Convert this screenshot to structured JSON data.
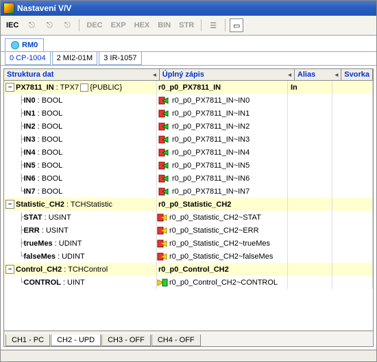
{
  "window": {
    "title": "Nastavení V/V"
  },
  "toolbar": {
    "iec": "IEC",
    "dec": "DEC",
    "exp": "EXP",
    "hex": "HEX",
    "bin": "BIN",
    "str": "STR"
  },
  "rm": {
    "label": "RM0"
  },
  "modules": [
    {
      "idx": "0",
      "name": "CP-1004"
    },
    {
      "idx": "2",
      "name": "MI2-01M"
    },
    {
      "idx": "3",
      "name": "IR-1057"
    }
  ],
  "columns": {
    "c1": "Struktura dat",
    "c2": "Úplný zápis",
    "c3": "Alias",
    "c4": "Svorka"
  },
  "rows": [
    {
      "kind": "group",
      "depth": 0,
      "name": "PX7811_IN",
      "type": "TPX7",
      "mod": "{PUBLIC}",
      "full": "r0_p0_PX7811_IN",
      "alias": "In",
      "icon": "none"
    },
    {
      "kind": "leaf",
      "depth": 1,
      "name": "IN0",
      "type": "BOOL",
      "full": "r0_p0_PX7811_IN~IN0",
      "icon": "green"
    },
    {
      "kind": "leaf",
      "depth": 1,
      "name": "IN1",
      "type": "BOOL",
      "full": "r0_p0_PX7811_IN~IN1",
      "icon": "green"
    },
    {
      "kind": "leaf",
      "depth": 1,
      "name": "IN2",
      "type": "BOOL",
      "full": "r0_p0_PX7811_IN~IN2",
      "icon": "green"
    },
    {
      "kind": "leaf",
      "depth": 1,
      "name": "IN3",
      "type": "BOOL",
      "full": "r0_p0_PX7811_IN~IN3",
      "icon": "green"
    },
    {
      "kind": "leaf",
      "depth": 1,
      "name": "IN4",
      "type": "BOOL",
      "full": "r0_p0_PX7811_IN~IN4",
      "icon": "green"
    },
    {
      "kind": "leaf",
      "depth": 1,
      "name": "IN5",
      "type": "BOOL",
      "full": "r0_p0_PX7811_IN~IN5",
      "icon": "green"
    },
    {
      "kind": "leaf",
      "depth": 1,
      "name": "IN6",
      "type": "BOOL",
      "full": "r0_p0_PX7811_IN~IN6",
      "icon": "green"
    },
    {
      "kind": "leaf",
      "depth": 1,
      "last": true,
      "name": "IN7",
      "type": "BOOL",
      "full": "r0_p0_PX7811_IN~IN7",
      "icon": "green"
    },
    {
      "kind": "group",
      "depth": 0,
      "name": "Statistic_CH2",
      "type": "TCHStatistic",
      "full": "r0_p0_Statistic_CH2",
      "icon": "none"
    },
    {
      "kind": "leaf",
      "depth": 1,
      "name": "STAT",
      "type": "USINT",
      "full": "r0_p0_Statistic_CH2~STAT",
      "icon": "yellow"
    },
    {
      "kind": "leaf",
      "depth": 1,
      "name": "ERR",
      "type": "USINT",
      "full": "r0_p0_Statistic_CH2~ERR",
      "icon": "yellow"
    },
    {
      "kind": "leaf",
      "depth": 1,
      "name": "trueMes",
      "type": "UDINT",
      "full": "r0_p0_Statistic_CH2~trueMes",
      "icon": "yellow"
    },
    {
      "kind": "leaf",
      "depth": 1,
      "last": true,
      "name": "falseMes",
      "type": "UDINT",
      "full": "r0_p0_Statistic_CH2~falseMes",
      "icon": "yellow"
    },
    {
      "kind": "group",
      "depth": 0,
      "name": "Control_CH2",
      "type": "TCHControl",
      "full": "r0_p0_Control_CH2",
      "icon": "none"
    },
    {
      "kind": "leaf",
      "depth": 1,
      "last": true,
      "name": "CONTROL",
      "type": "UINT",
      "full": "r0_p0_Control_CH2~CONTROL",
      "icon": "yellowout"
    }
  ],
  "bottomtabs": [
    "CH1 - PC",
    "CH2 - UPD",
    "CH3 - OFF",
    "CH4 - OFF"
  ]
}
